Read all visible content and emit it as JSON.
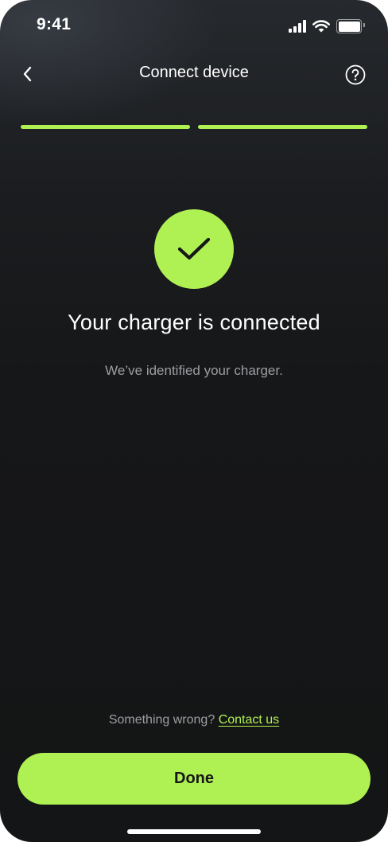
{
  "status_bar": {
    "time": "9:41",
    "icons": [
      "signal-icon",
      "wifi-icon",
      "battery-icon"
    ]
  },
  "header": {
    "title": "Connect device",
    "back_icon": "chevron-left-icon",
    "help_icon": "question-circle-icon"
  },
  "progress": {
    "total_steps": 2,
    "completed_steps": 2
  },
  "success": {
    "icon": "checkmark-icon",
    "title": "Your charger is connected",
    "subtitle": "We’ve identified your charger."
  },
  "footer": {
    "help_prefix": "Something wrong?",
    "contact_label": "Contact us",
    "done_label": "Done"
  },
  "colors": {
    "accent": "#AFF052",
    "background": "#161718",
    "muted_text": "#9C9EA2",
    "text": "#FFFFFF"
  }
}
